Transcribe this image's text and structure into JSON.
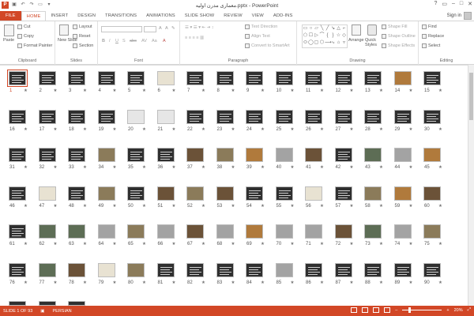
{
  "window": {
    "title": "معماری مدرن اولیه.pptx - PowerPoint",
    "app_icon": "P",
    "controls": [
      "?",
      "▭",
      "–",
      "□",
      "✕"
    ]
  },
  "ribbon_tabs": [
    "FILE",
    "HOME",
    "INSERT",
    "DESIGN",
    "TRANSITIONS",
    "ANIMATIONS",
    "SLIDE SHOW",
    "REVIEW",
    "VIEW",
    "ADD-INS"
  ],
  "sign_in": "Sign in",
  "ribbon": {
    "clipboard": {
      "paste": "Paste",
      "cut": "Cut",
      "copy": "Copy",
      "format_painter": "Format Painter",
      "label": "Clipboard"
    },
    "slides": {
      "new_slide": "New Slide",
      "layout": "Layout",
      "reset": "Reset",
      "section": "Section",
      "label": "Slides"
    },
    "font": {
      "label": "Font",
      "buttons": [
        "B",
        "I",
        "U",
        "S",
        "abc",
        "AV",
        "Aa",
        "A"
      ]
    },
    "paragraph": {
      "text_direction": "Text Direction",
      "align_text": "Align Text",
      "convert_smartart": "Convert to SmartArt",
      "label": "Paragraph"
    },
    "drawing": {
      "arrange": "Arrange",
      "quick_styles": "Quick Styles",
      "shape_fill": "Shape Fill",
      "shape_outline": "Shape Outline",
      "shape_effects": "Shape Effects",
      "label": "Drawing",
      "shapes": [
        "▭",
        "○",
        "▱",
        "╲",
        "╱",
        "↘",
        "△",
        "⌐",
        "⬠",
        "☐",
        "▷",
        "⌒",
        "{",
        "}",
        "☆",
        "◇",
        "⬭",
        "◯",
        "▢",
        "⬡",
        "⟶",
        "⤷",
        "⌂",
        "▿"
      ]
    },
    "editing": {
      "find": "Find",
      "replace": "Replace",
      "select": "Select",
      "label": "Editing"
    }
  },
  "slides": {
    "rows": [
      [
        "1",
        "2",
        "3",
        "4",
        "5",
        "6",
        "7",
        "8",
        "9",
        "10",
        "11",
        "12",
        "13",
        "14",
        "15"
      ],
      [
        "16",
        "17",
        "18",
        "19",
        "20",
        "21",
        "22",
        "23",
        "24",
        "25",
        "26",
        "27",
        "28",
        "29",
        "30"
      ],
      [
        "31",
        "32",
        "33",
        "34",
        "35",
        "36",
        "37",
        "38",
        "39",
        "40",
        "41",
        "42",
        "43",
        "44",
        "45"
      ],
      [
        "46",
        "47",
        "48",
        "49",
        "50",
        "51",
        "52",
        "53",
        "54",
        "55",
        "56",
        "57",
        "58",
        "59",
        "60"
      ],
      [
        "61",
        "62",
        "63",
        "64",
        "65",
        "66",
        "67",
        "68",
        "69",
        "70",
        "71",
        "72",
        "73",
        "74",
        "75"
      ],
      [
        "76",
        "77",
        "78",
        "79",
        "80",
        "81",
        "82",
        "83",
        "84",
        "85",
        "86",
        "87",
        "88",
        "89",
        "90"
      ]
    ],
    "star": "★",
    "selected": "1"
  },
  "status_bar": {
    "slide_indicator": "SLIDE 1 OF 93",
    "language": "PERSIAN",
    "zoom": "20%"
  }
}
